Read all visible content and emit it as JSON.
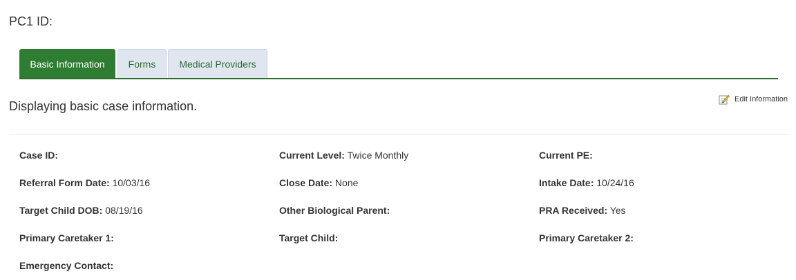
{
  "header": {
    "pc1_label": "PC1 ID:"
  },
  "tabs": [
    {
      "label": "Basic Information",
      "active": true
    },
    {
      "label": "Forms",
      "active": false
    },
    {
      "label": "Medical Providers",
      "active": false
    }
  ],
  "actions": {
    "edit_label": "Edit Information",
    "edit_icon": "edit-pencil-icon"
  },
  "main": {
    "subtitle": "Displaying basic case information."
  },
  "fields": {
    "case_id": {
      "label": "Case ID:",
      "value": ""
    },
    "current_level": {
      "label": "Current Level:",
      "value": "Twice Monthly"
    },
    "current_pe": {
      "label": "Current PE:",
      "value": ""
    },
    "referral_form_date": {
      "label": "Referral Form Date:",
      "value": "10/03/16"
    },
    "close_date": {
      "label": "Close Date:",
      "value": "None"
    },
    "intake_date": {
      "label": "Intake Date:",
      "value": "10/24/16"
    },
    "target_child_dob": {
      "label": "Target Child DOB:",
      "value": "08/19/16"
    },
    "other_biological_parent": {
      "label": "Other Biological Parent:",
      "value": ""
    },
    "pra_received": {
      "label": "PRA Received:",
      "value": "Yes"
    },
    "primary_caretaker_1": {
      "label": "Primary Caretaker 1:",
      "value": ""
    },
    "target_child": {
      "label": "Target Child:",
      "value": ""
    },
    "primary_caretaker_2": {
      "label": "Primary Caretaker 2:",
      "value": ""
    },
    "emergency_contact": {
      "label": "Emergency Contact:",
      "value": ""
    }
  },
  "colors": {
    "accent": "#2e7d32",
    "tab_inactive_bg": "#dfe6f0",
    "tab_text": "#2e6b2f"
  }
}
